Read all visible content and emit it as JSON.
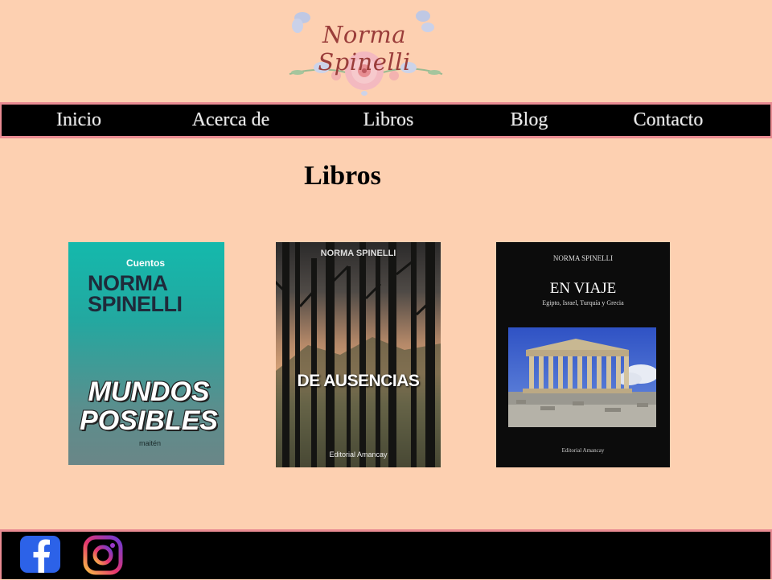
{
  "header": {
    "logo_text": "Norma Spinelli"
  },
  "nav": {
    "items": [
      {
        "label": "Inicio"
      },
      {
        "label": "Acerca de"
      },
      {
        "label": "Libros"
      },
      {
        "label": "Blog"
      },
      {
        "label": "Contacto"
      }
    ]
  },
  "main": {
    "title": "Libros",
    "books": [
      {
        "genre": "Cuentos",
        "author": "NORMA SPINELLI",
        "title": "MUNDOS POSIBLES",
        "publisher": "maitén"
      },
      {
        "author": "NORMA SPINELLI",
        "title": "DE AUSENCIAS",
        "publisher": "Editorial Amancay"
      },
      {
        "author": "NORMA SPINELLI",
        "title": "EN VIAJE",
        "subtitle": "Egipto, Israel, Turquía y Grecia",
        "publisher": "Editorial Amancay"
      }
    ]
  },
  "footer": {
    "social": [
      {
        "icon": "facebook-icon"
      },
      {
        "icon": "instagram-icon"
      }
    ]
  },
  "colors": {
    "background": "#fdd0b1",
    "nav_bg": "#000000",
    "nav_border": "#e98b92",
    "logo_text": "#9a3d3a"
  }
}
